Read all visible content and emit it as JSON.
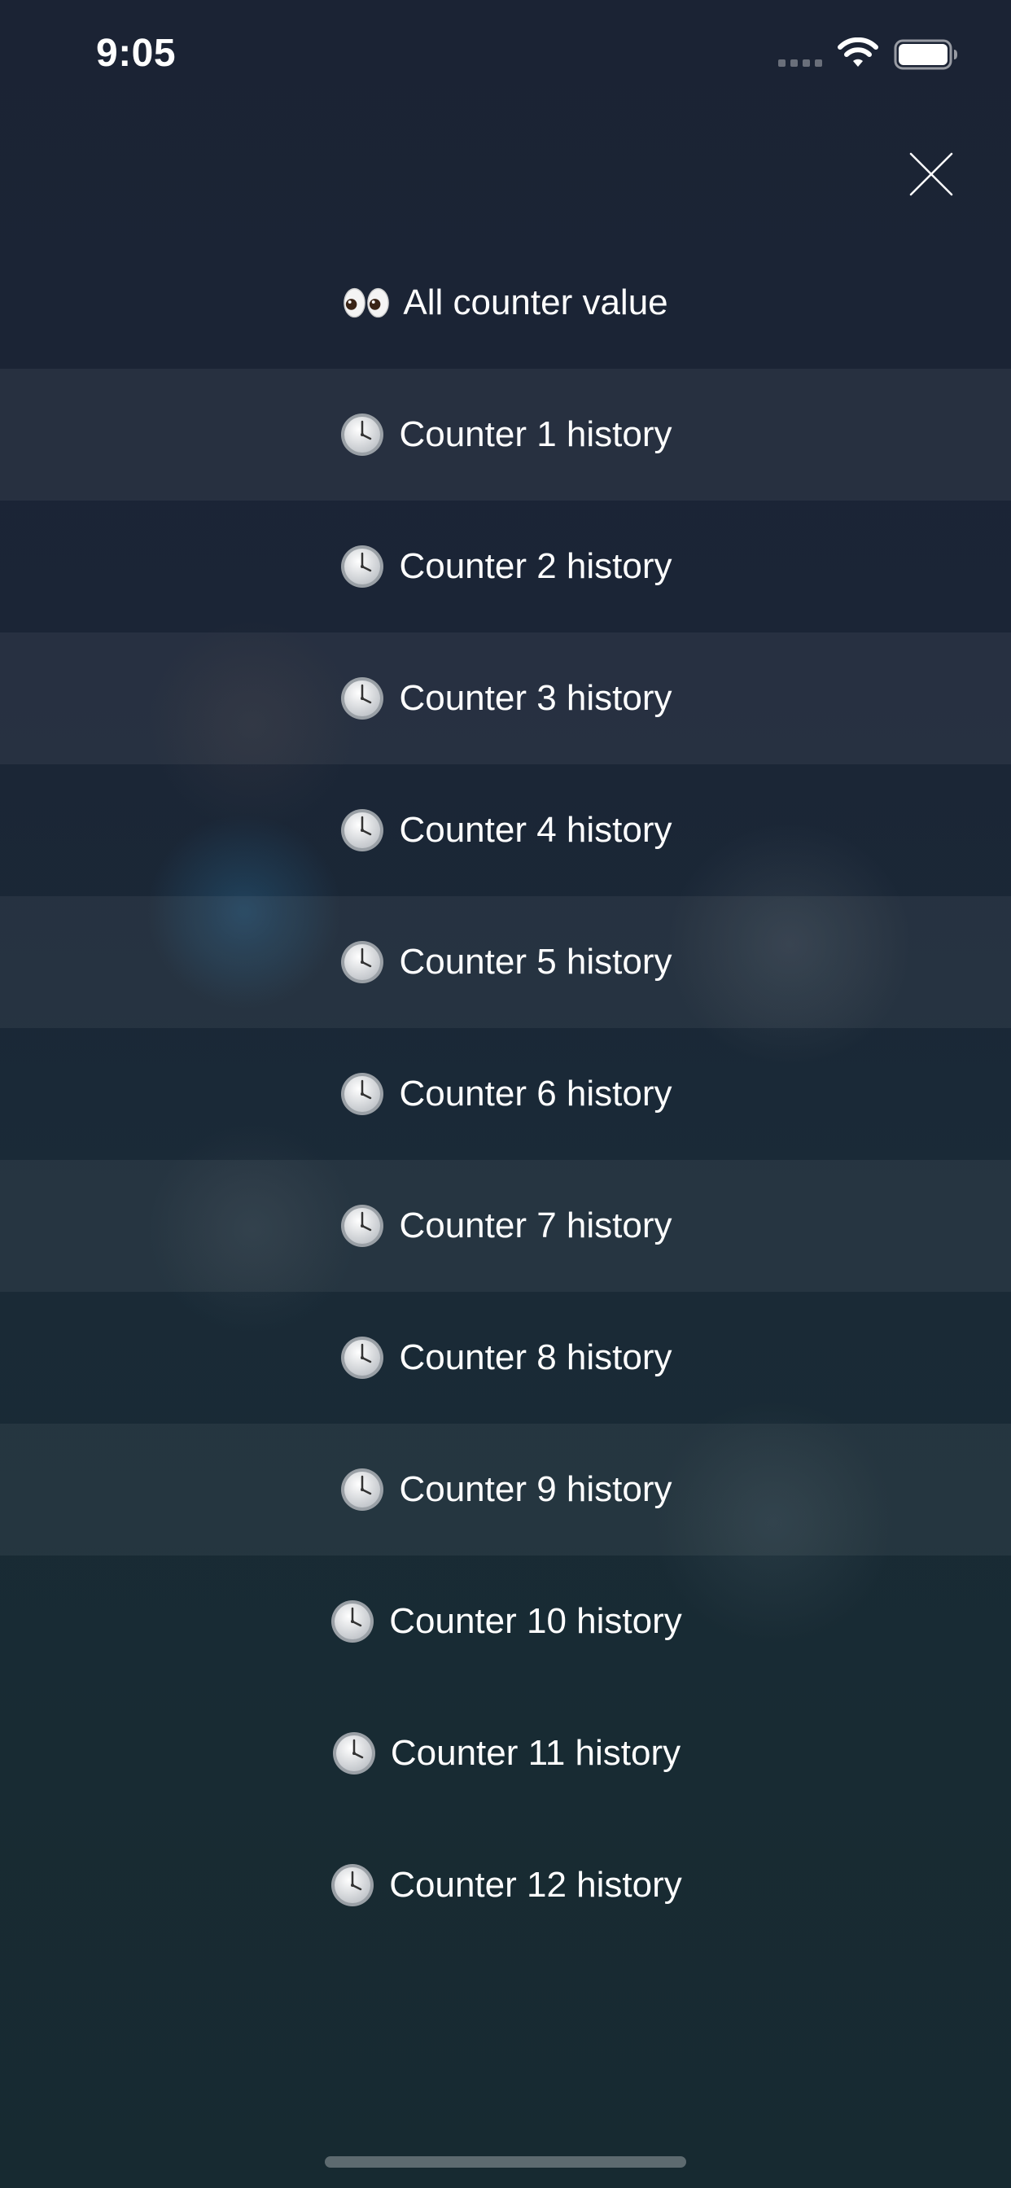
{
  "status_bar": {
    "time": "9:05",
    "icons": [
      "cellular-signal-icon",
      "wifi-icon",
      "battery-icon"
    ]
  },
  "header": {
    "close_icon": "close-icon"
  },
  "menu": {
    "items": [
      {
        "icon": "eyes-icon",
        "label": "All counter value"
      },
      {
        "icon": "clock-icon",
        "label": "Counter 1 history"
      },
      {
        "icon": "clock-icon",
        "label": "Counter 2 history"
      },
      {
        "icon": "clock-icon",
        "label": "Counter 3 history"
      },
      {
        "icon": "clock-icon",
        "label": "Counter 4 history"
      },
      {
        "icon": "clock-icon",
        "label": "Counter 5 history"
      },
      {
        "icon": "clock-icon",
        "label": "Counter 6 history"
      },
      {
        "icon": "clock-icon",
        "label": "Counter 7 history"
      },
      {
        "icon": "clock-icon",
        "label": "Counter 8 history"
      },
      {
        "icon": "clock-icon",
        "label": "Counter 9 history"
      },
      {
        "icon": "clock-icon",
        "label": "Counter 10 history"
      },
      {
        "icon": "clock-icon",
        "label": "Counter 11 history"
      },
      {
        "icon": "clock-icon",
        "label": "Counter 12 history"
      }
    ]
  },
  "colors": {
    "background_top": "#1b2334",
    "background_bottom": "#172a31",
    "text": "#ffffff"
  }
}
